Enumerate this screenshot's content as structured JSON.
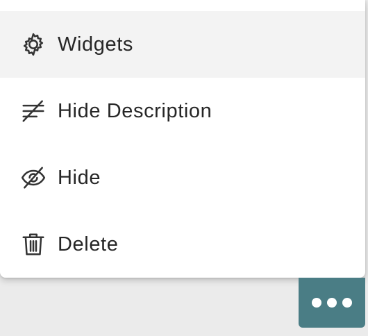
{
  "menu": {
    "items": [
      {
        "label": "Widgets",
        "icon": "gear-icon",
        "highlighted": true
      },
      {
        "label": "Hide Description",
        "icon": "text-strikethrough-icon",
        "highlighted": false
      },
      {
        "label": "Hide",
        "icon": "eye-off-icon",
        "highlighted": false
      },
      {
        "label": "Delete",
        "icon": "trash-icon",
        "highlighted": false
      }
    ]
  },
  "more_button": {
    "icon": "more-horizontal-icon",
    "color": "#4a7d85"
  },
  "colors": {
    "menu_background": "#ffffff",
    "highlight": "#f3f3f3",
    "page_background": "#ebebeb"
  }
}
